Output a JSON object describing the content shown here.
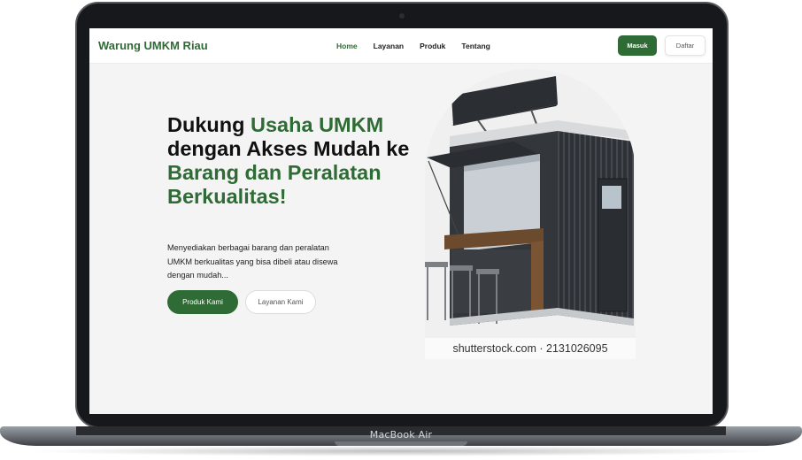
{
  "device": {
    "label": "MacBook Air"
  },
  "navbar": {
    "brand": "Warung UMKM Riau",
    "links": [
      {
        "label": "Home",
        "active": true
      },
      {
        "label": "Layanan",
        "active": false
      },
      {
        "label": "Produk",
        "active": false
      },
      {
        "label": "Tentang",
        "active": false
      }
    ],
    "login_label": "Masuk",
    "register_label": "Daftar"
  },
  "hero": {
    "title_part1": "Dukung ",
    "title_part2": "Usaha UMKM",
    "title_part3": " dengan Akses Mudah ke ",
    "title_part4": "Barang dan Peralatan Berkualitas!",
    "description": "Menyediakan berbagai barang dan peralatan UMKM berkualitas yang bisa dibeli atau disewa dengan mudah...",
    "primary_button": "Produk Kami",
    "secondary_button": "Layanan Kami",
    "image_watermark": "shutterstock.com · 2131026095"
  },
  "colors": {
    "accent": "#2f6b35",
    "screen_bg": "#f4f4f4"
  }
}
